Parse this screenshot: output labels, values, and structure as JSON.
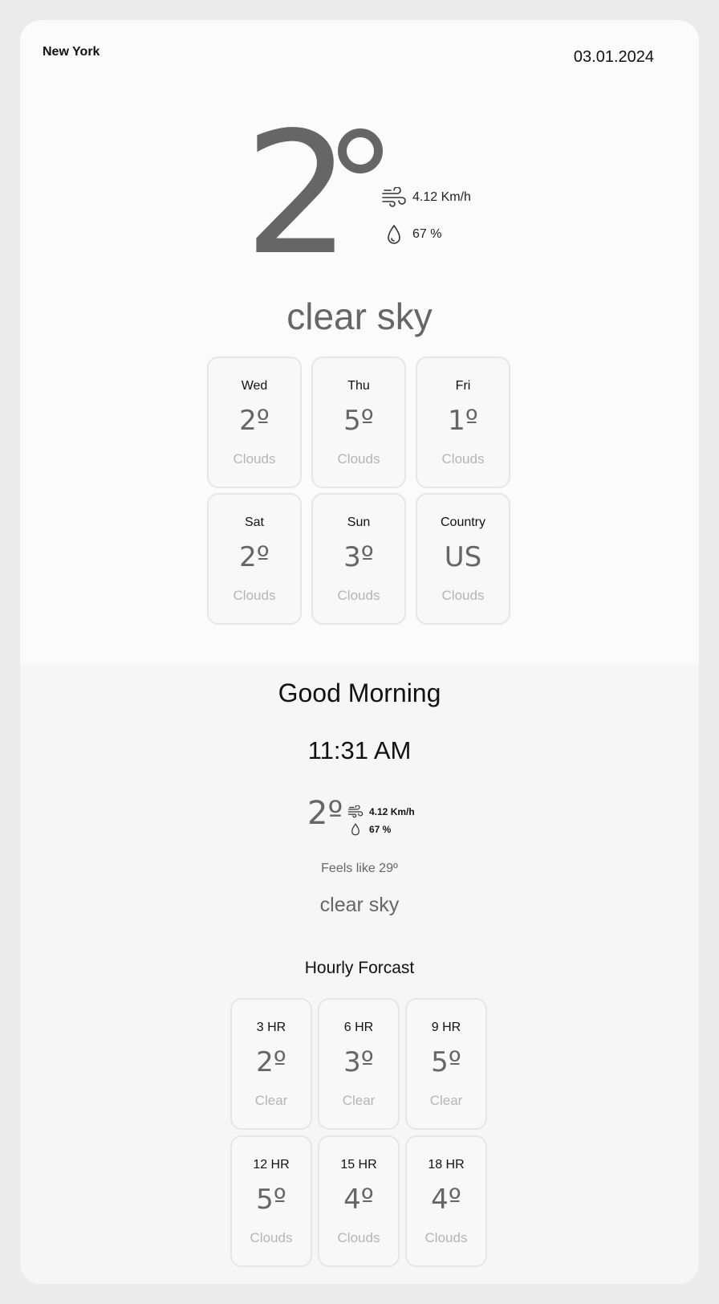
{
  "header": {
    "city": "New York",
    "date": "03.01.2024"
  },
  "current": {
    "temp": "2",
    "wind": "4.12 Km/h",
    "humidity": "67 %",
    "condition": "clear sky",
    "wind_icon": "wind-icon",
    "humidity_icon": "droplet-icon"
  },
  "forecast": [
    {
      "label": "Wed",
      "value": "2º",
      "desc": "Clouds"
    },
    {
      "label": "Thu",
      "value": "5º",
      "desc": "Clouds"
    },
    {
      "label": "Fri",
      "value": "1º",
      "desc": "Clouds"
    },
    {
      "label": "Sat",
      "value": "2º",
      "desc": "Clouds"
    },
    {
      "label": "Sun",
      "value": "3º",
      "desc": "Clouds"
    },
    {
      "label": "Country",
      "value": "US",
      "desc": "Clouds"
    }
  ],
  "summary": {
    "greeting": "Good Morning",
    "time": "11:31 AM",
    "temp": "2º",
    "wind": "4.12 Km/h",
    "humidity": "67 %",
    "feels_like": "Feels like 29º",
    "condition": "clear sky",
    "hourly_title": "Hourly Forcast"
  },
  "hourly": [
    {
      "label": "3 HR",
      "value": "2º",
      "desc": "Clear"
    },
    {
      "label": "6 HR",
      "value": "3º",
      "desc": "Clear"
    },
    {
      "label": "9 HR",
      "value": "5º",
      "desc": "Clear"
    },
    {
      "label": "12 HR",
      "value": "5º",
      "desc": "Clouds"
    },
    {
      "label": "15 HR",
      "value": "4º",
      "desc": "Clouds"
    },
    {
      "label": "18 HR",
      "value": "4º",
      "desc": "Clouds"
    }
  ],
  "colors": {
    "background": "#ebebeb",
    "card": "#fbfbfb",
    "muted": "#666666",
    "faint": "#b5b5b5",
    "border": "#e6e6e6"
  }
}
